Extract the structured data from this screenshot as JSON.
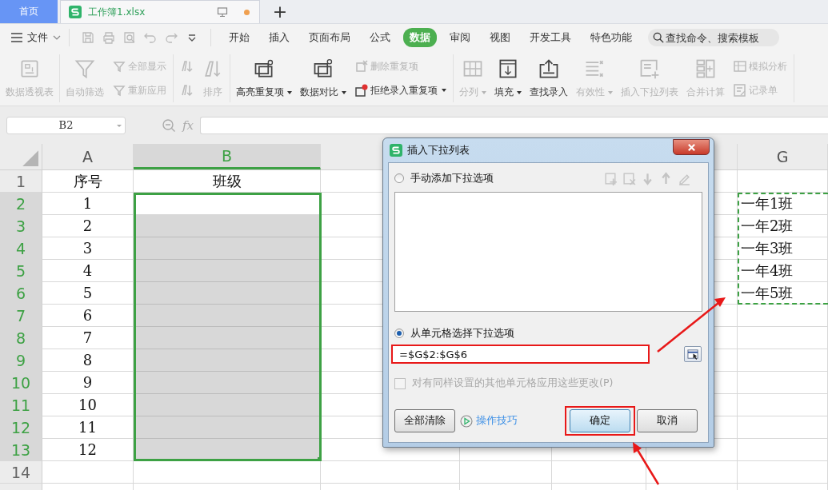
{
  "tabs": [
    {
      "kind": "home",
      "label": "首页",
      "selected": false
    },
    {
      "kind": "file",
      "label": "工作簿1.xlsx",
      "selected": true,
      "unsaved": true
    }
  ],
  "new_tab": "+",
  "file_menu": "文件",
  "ribbon_tabs": [
    {
      "label": "开始",
      "selected": false
    },
    {
      "label": "插入",
      "selected": false
    },
    {
      "label": "页面布局",
      "selected": false
    },
    {
      "label": "公式",
      "selected": false
    },
    {
      "label": "数据",
      "selected": true
    },
    {
      "label": "审阅",
      "selected": false
    },
    {
      "label": "视图",
      "selected": false
    },
    {
      "label": "开发工具",
      "selected": false
    },
    {
      "label": "特色功能",
      "selected": false
    }
  ],
  "search": {
    "placeholder": "查找命令、搜索模板"
  },
  "ribbon_groups": [
    {
      "items": [
        {
          "kind": "large",
          "label": "数据透视表",
          "disabled": true,
          "dropdown": false
        }
      ]
    },
    {
      "items": [
        {
          "kind": "large",
          "label": "自动筛选",
          "disabled": true,
          "dropdown": false
        },
        {
          "kind": "stack",
          "entries": [
            {
              "label": "全部显示",
              "disabled": true,
              "dropdown": false
            },
            {
              "label": "重新应用",
              "disabled": true,
              "dropdown": false
            }
          ]
        }
      ]
    },
    {
      "items": [
        {
          "kind": "stack",
          "entries": [
            {
              "disabled": true
            },
            {
              "disabled": true
            }
          ]
        },
        {
          "kind": "large",
          "label": "排序",
          "disabled": true,
          "dropdown": false
        }
      ]
    },
    {
      "items": [
        {
          "kind": "large",
          "label": "高亮重复项",
          "disabled": false,
          "dropdown": true
        },
        {
          "kind": "large",
          "label": "数据对比",
          "disabled": false,
          "dropdown": true
        },
        {
          "kind": "stack",
          "entries": [
            {
              "label": "删除重复项",
              "disabled": true,
              "dropdown": false
            },
            {
              "label": "拒绝录入重复项",
              "disabled": false,
              "dropdown": true
            }
          ]
        }
      ]
    },
    {
      "items": [
        {
          "kind": "large",
          "label": "分列",
          "disabled": true,
          "dropdown": true
        },
        {
          "kind": "large",
          "label": "填充",
          "disabled": false,
          "dropdown": true
        },
        {
          "kind": "large",
          "label": "查找录入",
          "disabled": false,
          "dropdown": false
        },
        {
          "kind": "large",
          "label": "有效性",
          "disabled": true,
          "dropdown": true
        },
        {
          "kind": "large",
          "label": "插入下拉列表",
          "disabled": true,
          "dropdown": false
        },
        {
          "kind": "large",
          "label": "合并计算",
          "disabled": true,
          "dropdown": false
        },
        {
          "kind": "stack",
          "entries": [
            {
              "label": "模拟分析",
              "disabled": true,
              "dropdown": false
            },
            {
              "label": "记录单",
              "disabled": true,
              "dropdown": false
            }
          ]
        }
      ]
    }
  ],
  "name_box": "B2",
  "fx": "fx",
  "sheet": {
    "columns": [
      {
        "label": "A",
        "selected": false
      },
      {
        "label": "B",
        "selected": true
      },
      {
        "label": "G",
        "selected": false
      }
    ],
    "rows": [
      {
        "number": "1",
        "selected": false,
        "a": "序号",
        "b": "班级"
      },
      {
        "number": "2",
        "selected": true,
        "active": true,
        "a": "1",
        "g": "一年1班"
      },
      {
        "number": "3",
        "selected": true,
        "active": false,
        "a": "2",
        "g": "一年2班"
      },
      {
        "number": "4",
        "selected": true,
        "active": false,
        "a": "3",
        "g": "一年3班"
      },
      {
        "number": "5",
        "selected": true,
        "active": false,
        "a": "4",
        "g": "一年4班"
      },
      {
        "number": "6",
        "selected": true,
        "active": false,
        "a": "5",
        "g": "一年5班"
      },
      {
        "number": "7",
        "selected": true,
        "active": false,
        "a": "6"
      },
      {
        "number": "8",
        "selected": true,
        "active": false,
        "a": "7"
      },
      {
        "number": "9",
        "selected": true,
        "active": false,
        "a": "8"
      },
      {
        "number": "10",
        "selected": true,
        "active": false,
        "a": "9"
      },
      {
        "number": "11",
        "selected": true,
        "active": false,
        "a": "10"
      },
      {
        "number": "12",
        "selected": true,
        "active": false,
        "a": "11"
      },
      {
        "number": "13",
        "selected": true,
        "active": false,
        "a": "12"
      },
      {
        "number": "14",
        "selected": false
      }
    ]
  },
  "dialog": {
    "title": "插入下拉列表",
    "options": [
      {
        "kind": "manual",
        "label": "手动添加下拉选项",
        "selected": false
      },
      {
        "kind": "cells",
        "label": "从单元格选择下拉选项",
        "selected": true
      }
    ],
    "list_tools": [
      {
        "disabled": true
      },
      {
        "disabled": true
      },
      {
        "disabled": true
      },
      {
        "disabled": true
      },
      {
        "disabled": true
      }
    ],
    "range": {
      "value": "=$G$2:$G$6",
      "highlighted": true
    },
    "apply_all": {
      "label": "对有同样设置的其他单元格应用这些更改(P)",
      "checked": false,
      "disabled": true
    },
    "clear_button": "全部清除",
    "tips_link": "操作技巧",
    "ok": {
      "label": "确定",
      "highlighted": true
    },
    "cancel": "取消"
  }
}
